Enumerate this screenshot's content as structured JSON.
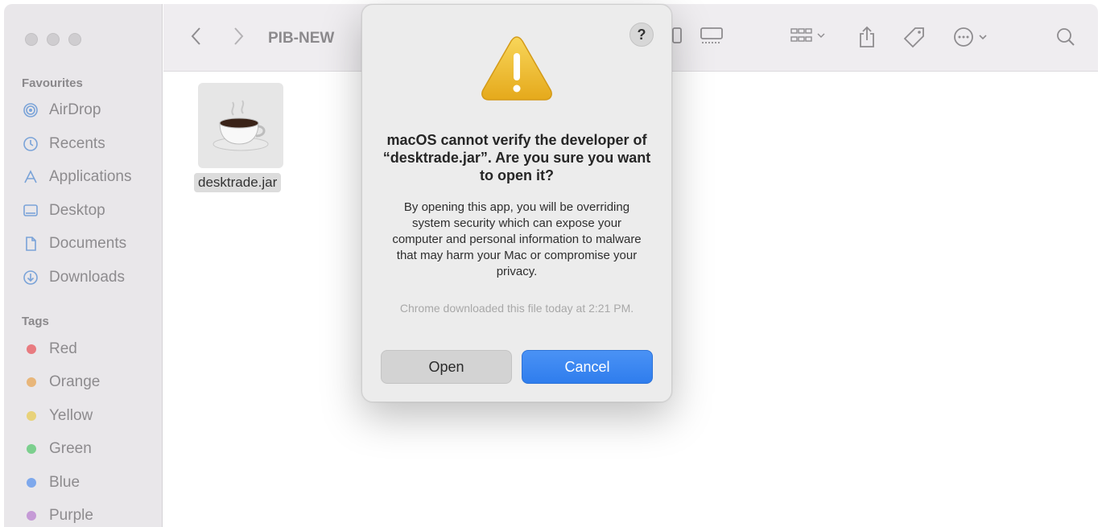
{
  "window": {
    "path_title": "PIB-NEW"
  },
  "sidebar": {
    "favourites_title": "Favourites",
    "favourites": [
      {
        "label": "AirDrop",
        "icon": "airdrop-icon"
      },
      {
        "label": "Recents",
        "icon": "clock-icon"
      },
      {
        "label": "Applications",
        "icon": "applications-icon"
      },
      {
        "label": "Desktop",
        "icon": "desktop-icon"
      },
      {
        "label": "Documents",
        "icon": "document-icon"
      },
      {
        "label": "Downloads",
        "icon": "download-icon"
      }
    ],
    "tags_title": "Tags",
    "tags": [
      {
        "label": "Red",
        "color": "#e87b80"
      },
      {
        "label": "Orange",
        "color": "#e8b67a"
      },
      {
        "label": "Yellow",
        "color": "#e8d27a"
      },
      {
        "label": "Green",
        "color": "#7ccf8e"
      },
      {
        "label": "Blue",
        "color": "#7ea8ec"
      },
      {
        "label": "Purple",
        "color": "#c59ad6"
      }
    ]
  },
  "file": {
    "name": "desktrade.jar",
    "icon": "java-coffee-cup-icon"
  },
  "dialog": {
    "help_label": "?",
    "title": "macOS cannot verify the developer of “desktrade.jar”. Are you sure you want to open it?",
    "body": "By opening this app, you will be overriding system security which can expose your computer and personal information to malware that may harm your Mac or compromise your privacy.",
    "note": "Chrome downloaded this file today at 2:21 PM.",
    "open_label": "Open",
    "cancel_label": "Cancel"
  },
  "colors": {
    "accent": "#3b86f2",
    "warning": "#f2c230"
  }
}
